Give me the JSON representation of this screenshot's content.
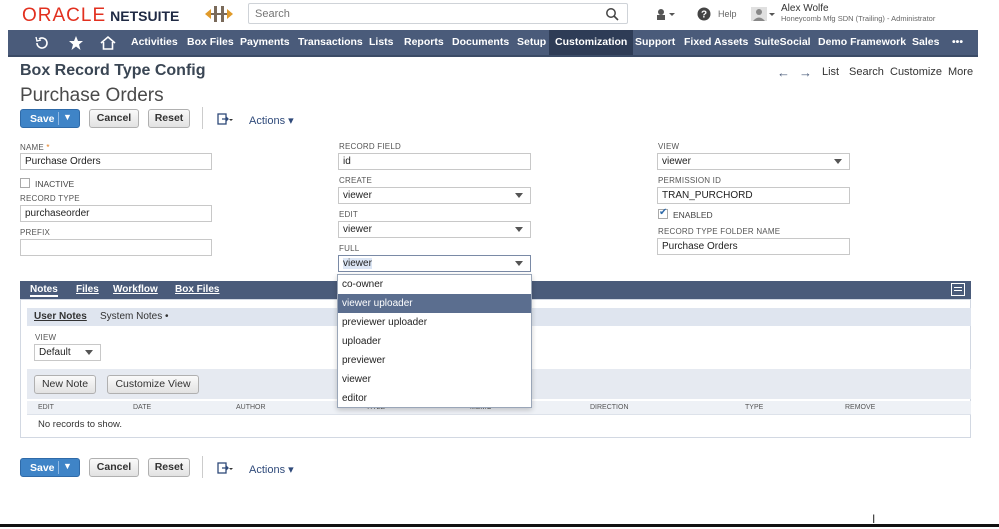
{
  "header": {
    "logo_oracle": "ORACLE",
    "logo_netsuite": "NETSUITE",
    "search_placeholder": "Search",
    "help_label": "Help",
    "user_name": "Alex Wolfe",
    "user_subtitle": "Honeycomb Mfg SDN (Trailing) - Administrator"
  },
  "nav": {
    "items": [
      "Activities",
      "Box Files",
      "Payments",
      "Transactions",
      "Lists",
      "Reports",
      "Documents",
      "Setup",
      "Customization",
      "Support",
      "Fixed Assets",
      "SuiteSocial",
      "Demo Framework",
      "Sales",
      "•••"
    ],
    "active": "Customization"
  },
  "page": {
    "title": "Box Record Type Config",
    "record_name": "Purchase Orders",
    "record_nav": [
      "List",
      "Search",
      "Customize",
      "More"
    ]
  },
  "buttons": {
    "save": "Save",
    "cancel": "Cancel",
    "reset": "Reset",
    "actions": "Actions ▾"
  },
  "form": {
    "name_label": "NAME",
    "name_value": "Purchase Orders",
    "inactive_label": "INACTIVE",
    "record_type_label": "RECORD TYPE",
    "record_type_value": "purchaseorder",
    "prefix_label": "PREFIX",
    "prefix_value": "",
    "record_field_label": "RECORD FIELD",
    "record_field_value": "id",
    "create_label": "CREATE",
    "create_value": "viewer",
    "edit_label": "EDIT",
    "edit_value": "viewer",
    "full_label": "FULL",
    "full_value": "viewer",
    "view_label": "VIEW",
    "view_value": "viewer",
    "permission_label": "PERMISSION ID",
    "permission_value": "TRAN_PURCHORD",
    "enabled_label": "ENABLED",
    "enabled": true,
    "folder_label": "RECORD TYPE FOLDER NAME",
    "folder_value": "Purchase Orders"
  },
  "dropdown": {
    "options": [
      "co-owner",
      "viewer uploader",
      "previewer uploader",
      "uploader",
      "previewer",
      "viewer",
      "editor"
    ],
    "highlighted": "viewer uploader"
  },
  "subtabs": {
    "items": [
      "Notes",
      "Files",
      "Workflow",
      "Box Files"
    ],
    "active": "Notes",
    "inner": [
      "User Notes",
      "System Notes •"
    ],
    "view_label": "VIEW",
    "view_value": "Default",
    "new_note": "New Note",
    "customize_view": "Customize View",
    "columns": [
      "EDIT",
      "DATE",
      "AUTHOR",
      "TITLE",
      "MEMO",
      "DIRECTION",
      "TYPE",
      "REMOVE"
    ],
    "no_records": "No records to show."
  },
  "colors": {
    "nav_bg": "#4a5b7a",
    "save_blue": "#3f84c7",
    "oracle_red": "#e2301f"
  }
}
